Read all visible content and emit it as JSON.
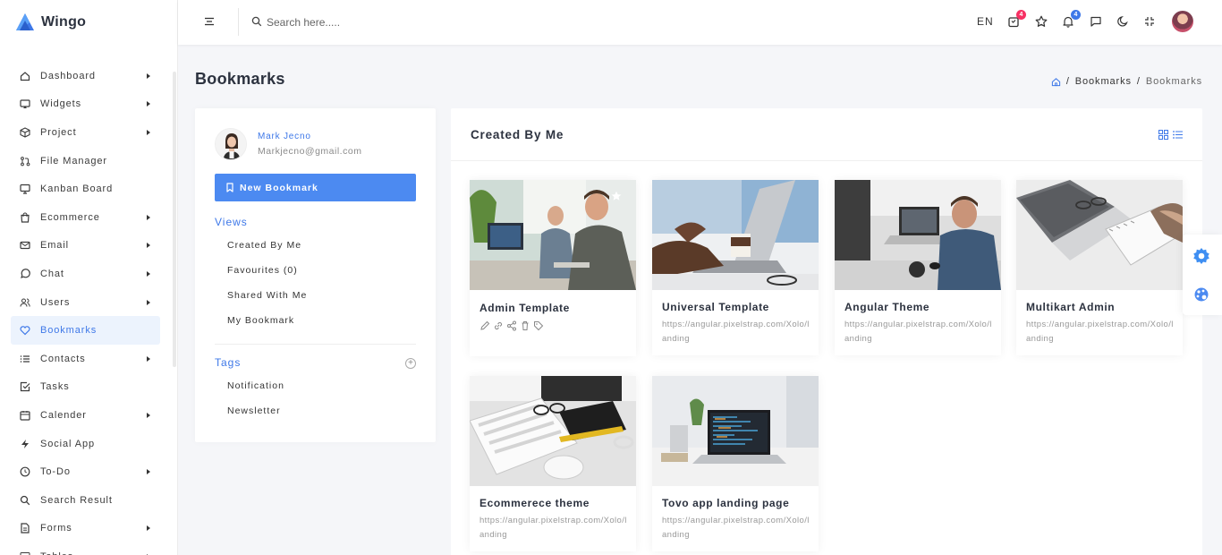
{
  "brand": {
    "name": "Wingo"
  },
  "sidebar": {
    "items": [
      {
        "label": "Dashboard",
        "icon": "home-icon",
        "arrow": true
      },
      {
        "label": "Widgets",
        "icon": "airplay-icon",
        "arrow": true
      },
      {
        "label": "Project",
        "icon": "box-icon",
        "arrow": true
      },
      {
        "label": "File Manager",
        "icon": "git-pull-icon",
        "arrow": false
      },
      {
        "label": "Kanban Board",
        "icon": "monitor-icon",
        "arrow": false
      },
      {
        "label": "Ecommerce",
        "icon": "shopping-bag-icon",
        "arrow": true
      },
      {
        "label": "Email",
        "icon": "mail-icon",
        "arrow": true
      },
      {
        "label": "Chat",
        "icon": "message-circle-icon",
        "arrow": true
      },
      {
        "label": "Users",
        "icon": "users-icon",
        "arrow": true
      },
      {
        "label": "Bookmarks",
        "icon": "heart-icon",
        "arrow": false
      },
      {
        "label": "Contacts",
        "icon": "list-icon",
        "arrow": true
      },
      {
        "label": "Tasks",
        "icon": "check-square-icon",
        "arrow": false
      },
      {
        "label": "Calender",
        "icon": "calendar-icon",
        "arrow": true
      },
      {
        "label": "Social App",
        "icon": "zap-icon",
        "arrow": false
      },
      {
        "label": "To-Do",
        "icon": "clock-icon",
        "arrow": true
      },
      {
        "label": "Search Result",
        "icon": "search-icon",
        "arrow": false
      },
      {
        "label": "Forms",
        "icon": "file-text-icon",
        "arrow": true
      },
      {
        "label": "Tables",
        "icon": "server-icon",
        "arrow": true
      }
    ],
    "active_index": 9
  },
  "header": {
    "search_placeholder": "Search here.....",
    "language": "EN",
    "cart_count": "4",
    "notification_count": "4"
  },
  "page": {
    "title": "Bookmarks",
    "breadcrumb": [
      "Bookmarks",
      "Bookmarks"
    ]
  },
  "profile": {
    "name": "Mark Jecno",
    "email": "Markjecno@gmail.com"
  },
  "panel": {
    "new_button": "New Bookmark",
    "views_title": "Views",
    "views": [
      "Created By Me",
      "Favourites (0)",
      "Shared With Me",
      "My Bookmark"
    ],
    "tags_title": "Tags",
    "tags": [
      "Notification",
      "Newsletter"
    ]
  },
  "main": {
    "title": "Created By Me",
    "bookmarks": [
      {
        "title": "Admin Template",
        "url": "",
        "starred": true
      },
      {
        "title": "Universal Template",
        "url": "https://angular.pixelstrap.com/Xolo/landing",
        "starred": false
      },
      {
        "title": "Angular Theme",
        "url": "https://angular.pixelstrap.com/Xolo/landing",
        "starred": false
      },
      {
        "title": "Multikart Admin",
        "url": "https://angular.pixelstrap.com/Xolo/landing",
        "starred": false
      },
      {
        "title": "Ecommerece theme",
        "url": "https://angular.pixelstrap.com/Xolo/landing",
        "starred": false
      },
      {
        "title": "Tovo app landing page",
        "url": "https://angular.pixelstrap.com/Xolo/landing",
        "starred": false
      }
    ]
  },
  "colors": {
    "primary": "#4c8af1",
    "accent_blue": "#3e78e8",
    "badge_red": "#f73164",
    "badge_blue": "#3e78e8"
  }
}
